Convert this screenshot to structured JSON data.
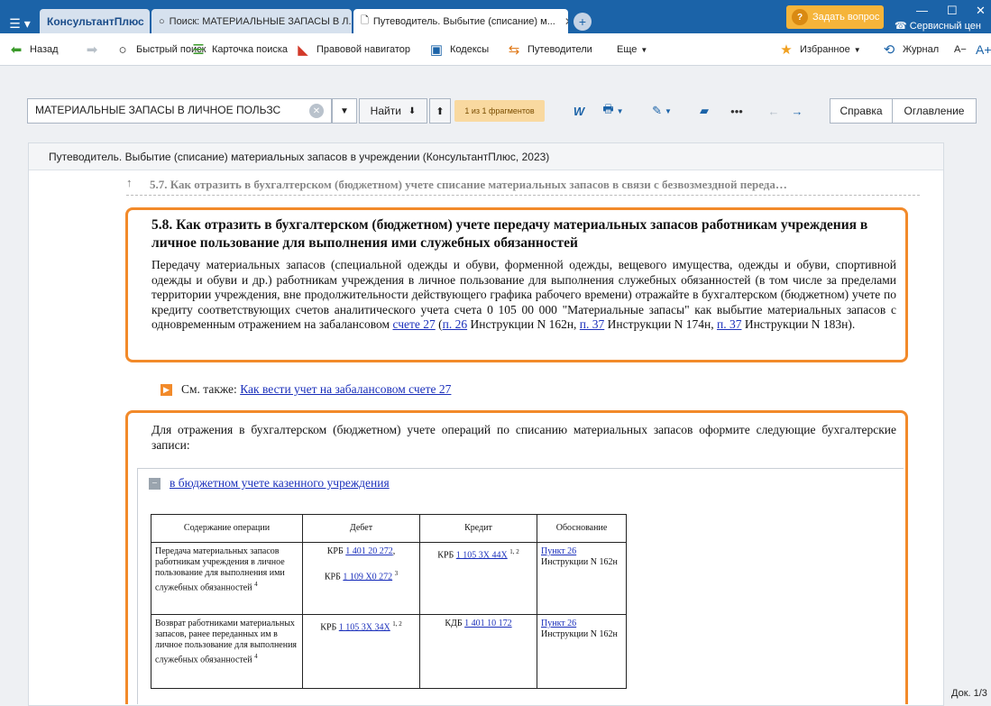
{
  "titlebar": {
    "tabs": [
      {
        "label": "КонсультантПлюс"
      },
      {
        "label": "Поиск: МАТЕРИАЛЬНЫЕ ЗАПАСЫ В Л..."
      },
      {
        "label": "Путеводитель. Выбытие (списание) м..."
      }
    ],
    "ask_label": "Задать вопрос",
    "service_label": "Сервисный цен"
  },
  "toolbar": {
    "back": "Назад",
    "quick_search": "Быстрый поиск",
    "search_card": "Карточка поиска",
    "legal_navigator": "Правовой навигатор",
    "codes": "Кодексы",
    "guides": "Путеводители",
    "more": "Еще",
    "favorites": "Избранное",
    "journal": "Журнал",
    "font_minus": "A−",
    "font_plus": "A+"
  },
  "search": {
    "value": "МАТЕРИАЛЬНЫЕ ЗАПАСЫ В ЛИЧНОЕ ПОЛЬЗС",
    "find_label": "Найти",
    "fragments": "1 из 1 фрагментов",
    "help_label": "Справка",
    "toc_label": "Оглавление"
  },
  "doc": {
    "header": "Путеводитель. Выбытие (списание) материальных запасов в учреждении (КонсультантПлюс, 2023)",
    "prev_section": "5.7. Как отразить в бухгалтерском (бюджетном) учете списание материальных запасов в связи с безвозмездной переда…",
    "section_title": "5.8. Как отразить в бухгалтерском (бюджетном) учете передачу материальных запасов работникам учреждения в личное пользование для выполнения ими служебных обязанностей",
    "para_main": "Передачу материальных запасов (специальной одежды и обуви, форменной одежды, вещевого имущества, одежды и обуви, спортивной одежды и обуви и др.) работникам учреждения в личное пользование для выполнения служебных обязанностей (в том числе за пределами территории учреждения, вне продолжительности действующего графика рабочего времени) отражайте в бухгалтерском (бюджетном) учете по кредиту соответствующих счетов аналитического учета счета 0 105 00 000 \"Материальные запасы\" как выбытие материальных запасов с одновременным отражением на забалансовом ",
    "link_account27": "счете 27",
    "link_p26": "п. 26",
    "text_instr162": " Инструкции N 162н, ",
    "link_p37a": "п. 37",
    "text_instr174": " Инструкции N 174н, ",
    "link_p37b": "п. 37",
    "text_instr183": " Инструкции N 183н).",
    "see_also_label": "См. также:",
    "see_also_link": "Как вести учет на забалансовом счете 27",
    "para_entries": "Для отражения в бухгалтерском (бюджетном) учете операций по списанию материальных запасов оформите следующие бухгалтерские записи:",
    "collapse_link": "в бюджетном учете казенного учреждения",
    "table": {
      "headers": [
        "Содержание операции",
        "Дебет",
        "Кредит",
        "Обоснование"
      ],
      "rows": [
        {
          "content": "Передача материальных запасов работникам учреждения в личное пользование для выполнения ими служебных обязанностей",
          "content_sup": "4",
          "debit1_prefix": "КРБ ",
          "debit1_link": "1 401 20 272",
          "debit2_prefix": "КРБ ",
          "debit2_link": "1 109 Х0 272",
          "debit2_sup": "3",
          "credit_prefix": "КРБ ",
          "credit_link": "1 105 3Х 44Х",
          "credit_sup": "1, 2",
          "basis_link": "Пункт 26",
          "basis_text": "Инструкции N 162н"
        },
        {
          "content": "Возврат работниками материальных запасов, ранее переданных им в личное пользование для выполнения служебных обязанностей",
          "content_sup": "4",
          "debit1_prefix": "КРБ ",
          "debit1_link": "1 105 3Х 34Х",
          "debit1_sup": "1, 2",
          "credit_prefix": "КДБ ",
          "credit_link": "1 401 10 172",
          "basis_link": "Пункт 26",
          "basis_text": "Инструкции N 162н"
        }
      ]
    }
  },
  "status": {
    "doc_counter": "Док. 1/3"
  }
}
